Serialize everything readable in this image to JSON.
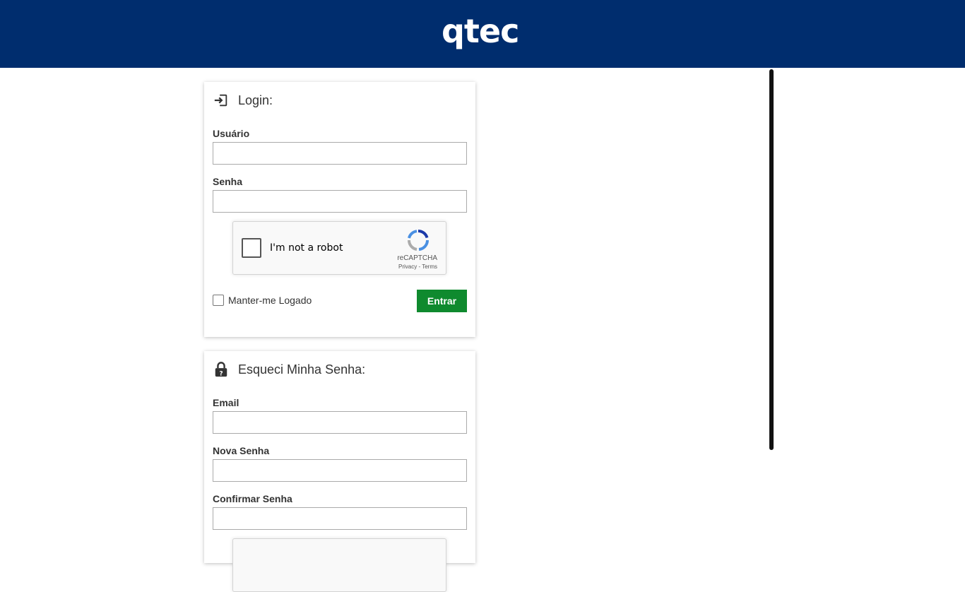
{
  "header": {
    "logo_text": "qtec",
    "bg_color": "#002d6e"
  },
  "login": {
    "title": "Login:",
    "icon": "login-icon",
    "username_label": "Usuário",
    "username_value": "",
    "password_label": "Senha",
    "password_value": "",
    "captcha": {
      "text": "I'm not a robot",
      "brand": "reCAPTCHA",
      "terms": "Privacy - Terms"
    },
    "remember_label": "Manter-me Logado",
    "submit_label": "Entrar",
    "submit_color": "#0f8a2e"
  },
  "forgot": {
    "title": "Esqueci Minha Senha:",
    "icon": "lock-question-icon",
    "email_label": "Email",
    "email_value": "",
    "new_password_label": "Nova Senha",
    "new_password_value": "",
    "confirm_password_label": "Confirmar Senha",
    "confirm_password_value": ""
  }
}
